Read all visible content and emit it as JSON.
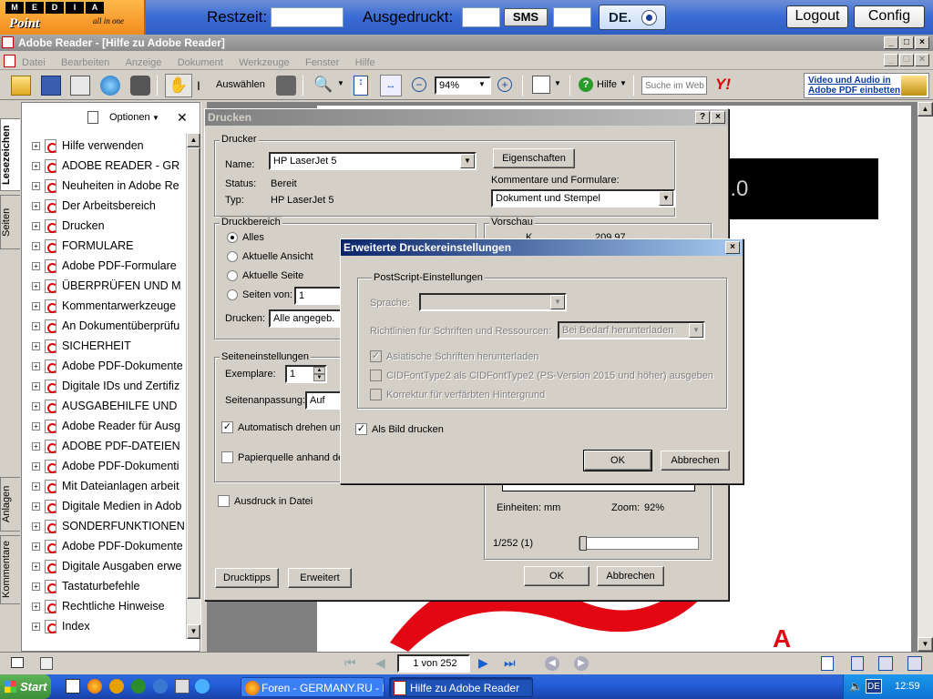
{
  "kiosk": {
    "logo_top": [
      "M",
      "E",
      "D",
      "I",
      "A"
    ],
    "logo_brand": "Point",
    "logo_tag": "all in one",
    "restzeit_label": "Restzeit:",
    "ausgedruckt_label": "Ausgedruckt:",
    "sms_label": "SMS",
    "language_label": "DE.",
    "logout_label": "Logout",
    "config_label": "Config"
  },
  "app": {
    "title": "Adobe Reader - [Hilfe zu Adobe Reader]",
    "menu": [
      "Datei",
      "Bearbeiten",
      "Anzeige",
      "Dokument",
      "Werkzeuge",
      "Fenster",
      "Hilfe"
    ],
    "toolbar": {
      "select_label": "Auswählen",
      "zoom_value": "94%",
      "help_label": "Hilfe",
      "search_placeholder": "Suche im Web",
      "promo_line1": "Video und Audio in",
      "promo_line2": "Adobe PDF einbetten"
    }
  },
  "sidebar": {
    "options_label": "Optionen",
    "tabs": [
      "Lesezeichen",
      "Seiten",
      "Anlagen",
      "Kommentare"
    ],
    "items": [
      "Hilfe verwenden",
      "ADOBE READER - GR",
      "Neuheiten in Adobe Re",
      "Der Arbeitsbereich",
      "Drucken",
      "FORMULARE",
      "Adobe PDF-Formulare",
      "ÜBERPRÜFEN UND M",
      "Kommentarwerkzeuge",
      "An Dokumentüberprüfu",
      "SICHERHEIT",
      "Adobe PDF-Dokumente",
      "Digitale IDs und Zertifiz",
      "AUSGABEHILFE UND",
      "Adobe Reader für Ausg",
      "ADOBE PDF-DATEIEN",
      "Adobe PDF-Dokumenti",
      "Mit Dateianlagen arbeit",
      "Digitale Medien in Adob",
      "SONDERFUNKTIONEN",
      "Adobe PDF-Dokumente",
      "Digitale Ausgaben erwe",
      "Tastaturbefehle",
      "Rechtliche Hinweise",
      "Index"
    ]
  },
  "document": {
    "banner_text": "7.0",
    "page_input": "1 von 252"
  },
  "print_dialog": {
    "title": "Drucken",
    "printer_group": "Drucker",
    "name_label": "Name:",
    "name_value": "HP LaserJet 5",
    "properties_button": "Eigenschaften",
    "status_label": "Status:",
    "status_value": "Bereit",
    "type_label": "Typ:",
    "type_value": "HP LaserJet 5",
    "comments_label": "Kommentare und Formulare:",
    "comments_value": "Dokument und Stempel",
    "range_group": "Druckbereich",
    "range_all": "Alles",
    "range_current_view": "Aktuelle Ansicht",
    "range_current_page": "Aktuelle Seite",
    "range_pages": "Seiten von:",
    "range_pages_value": "1",
    "print_label": "Drucken:",
    "print_value": "Alle angegeb. S",
    "page_setup_group": "Seiteneinstellungen",
    "copies_label": "Exemplare:",
    "copies_value": "1",
    "scaling_label": "Seitenanpassung:",
    "scaling_value": "Auf Grö",
    "auto_rotate_label": "Automatisch drehen und",
    "paper_source_label": "Papierquelle anhand de",
    "print_to_file_label": "Ausdruck in Datei",
    "preview_group": "Vorschau",
    "preview_k_label": "K",
    "preview_dim": "209,97",
    "units_label": "Einheiten: mm",
    "zoom_label": "Zoom:",
    "zoom_value": "92%",
    "page_counter": "1/252 (1)",
    "tips_button": "Drucktipps",
    "advanced_button": "Erweitert",
    "ok_button": "OK",
    "cancel_button": "Abbrechen"
  },
  "advanced_dialog": {
    "title": "Erweiterte Druckereinstellungen",
    "postscript_group": "PostScript-Einstellungen",
    "language_label": "Sprache:",
    "font_policy_label": "Richtlinien für Schriften und Ressourcen:",
    "font_policy_value": "Bei Bedarf herunterladen",
    "asian_fonts_label": "Asiatische Schriften herunterladen",
    "cidfont_label": "CIDFontType2 als CIDFontType2 (PS-Version 2015 und höher) ausgeben",
    "color_bg_label": "Korrektur für verfärbten Hintergrund",
    "as_image_label": "Als Bild drucken",
    "ok_button": "OK",
    "cancel_button": "Abbrechen"
  },
  "taskbar": {
    "start_label": "Start",
    "task1": "Foren - GERMANY.RU - Г...",
    "task2": "Hilfe zu Adobe Reader",
    "lang": "DE",
    "clock": "12:59"
  },
  "colors": {
    "active_title": "#0a246a",
    "taskbar": "#245edb",
    "kiosk_bar": "#3a6ad4",
    "adobe_red": "#e30613"
  }
}
